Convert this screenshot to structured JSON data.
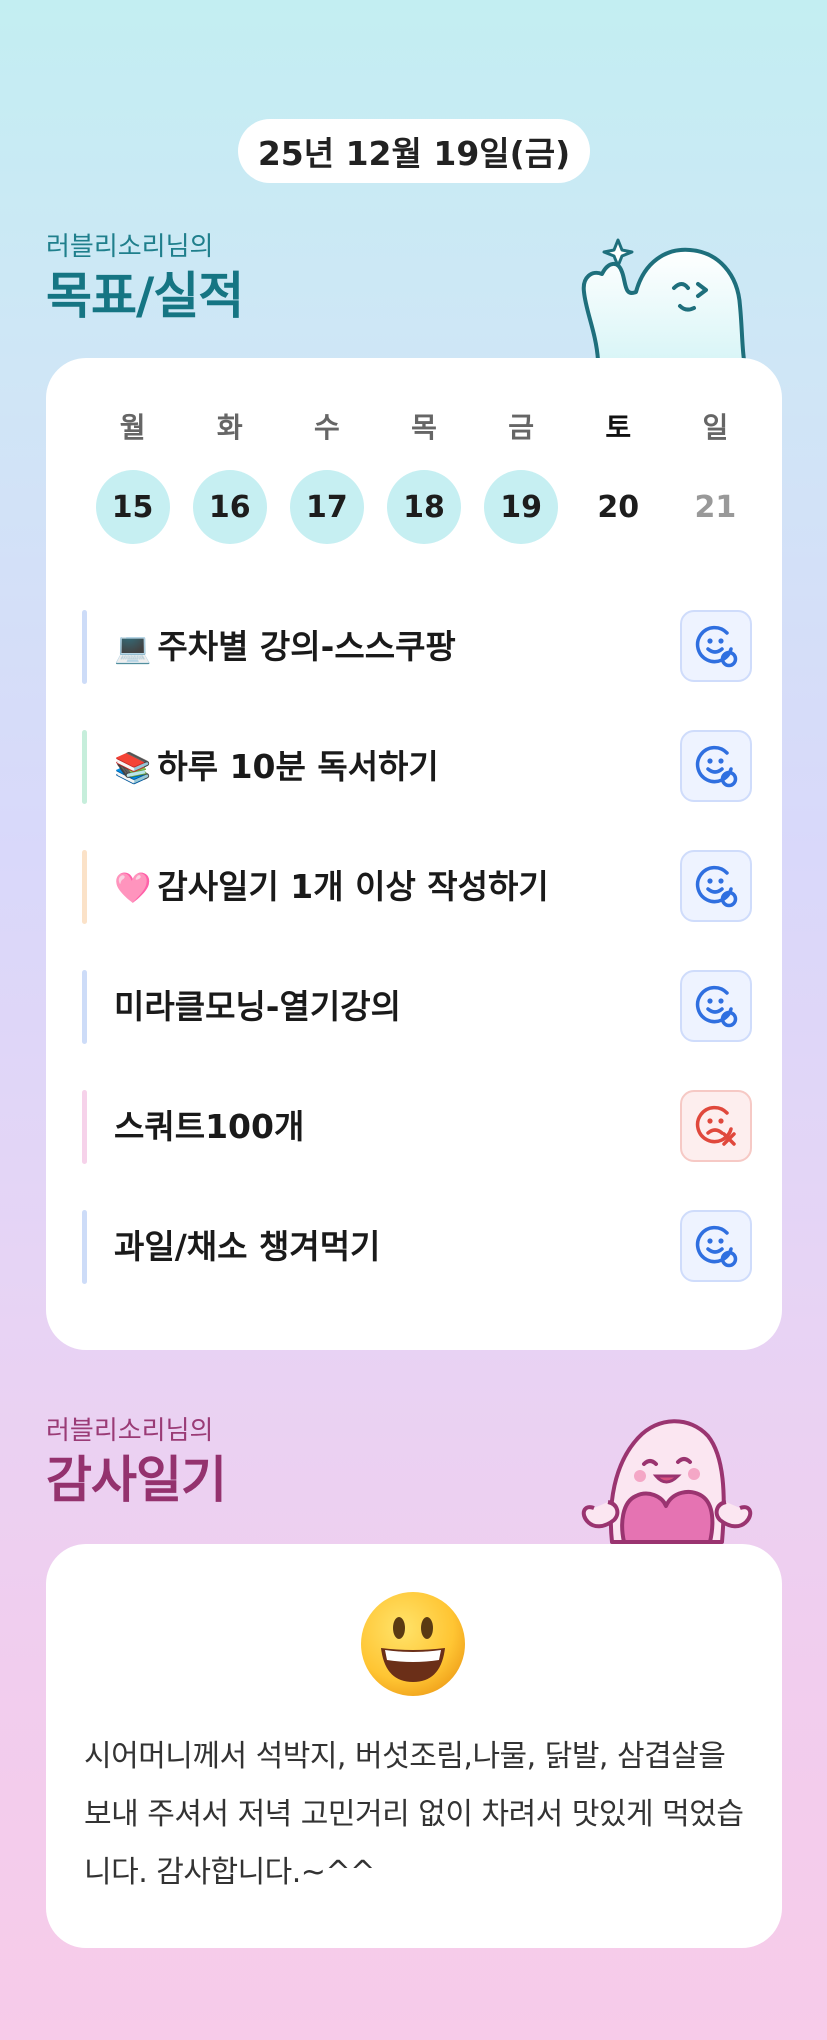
{
  "date_label": "25년 12월 19일(금)",
  "goals_section": {
    "subtitle": "러블리소리님의",
    "title": "목표/실적"
  },
  "week": [
    {
      "day": "월",
      "date": "15",
      "done": true
    },
    {
      "day": "화",
      "date": "16",
      "done": true
    },
    {
      "day": "수",
      "date": "17",
      "done": true
    },
    {
      "day": "목",
      "date": "18",
      "done": true
    },
    {
      "day": "금",
      "date": "19",
      "done": true
    },
    {
      "day": "토",
      "date": "20",
      "done": false
    },
    {
      "day": "일",
      "date": "21",
      "done": false
    }
  ],
  "goals": [
    {
      "emoji": "💻",
      "text": "주차별 강의-스스쿠팡",
      "status": "done",
      "bar_color": "#cddcf8"
    },
    {
      "emoji": "📚",
      "text": "하루 10분 독서하기",
      "status": "done",
      "bar_color": "#c6eedb"
    },
    {
      "emoji": "🩷",
      "text": "감사일기 1개 이상 작성하기",
      "status": "done",
      "bar_color": "#fbe2c8"
    },
    {
      "emoji": "",
      "text": "미라클모닝-열기강의",
      "status": "done",
      "bar_color": "#cddcf8"
    },
    {
      "emoji": "",
      "text": "스쿼트100개",
      "status": "fail",
      "bar_color": "#f6d2ea"
    },
    {
      "emoji": "",
      "text": "과일/채소 챙겨먹기",
      "status": "done",
      "bar_color": "#cddcf8"
    }
  ],
  "diary_section": {
    "subtitle": "러블리소리님의",
    "title": "감사일기",
    "emoji": "😃",
    "text": "시어머니께서 석박지, 버섯조림,나물, 닭발, 삼겹살을 보내 주셔서 저녁 고민거리 없이 차려서 맛있게 먹었습니다. 감사합니다.~^^"
  },
  "colors": {
    "goal_title": "#157583",
    "diary_title": "#94326e",
    "done_circle": "#c6eff2",
    "done_icon": "#2f6fe0",
    "fail_icon": "#e0483c"
  }
}
